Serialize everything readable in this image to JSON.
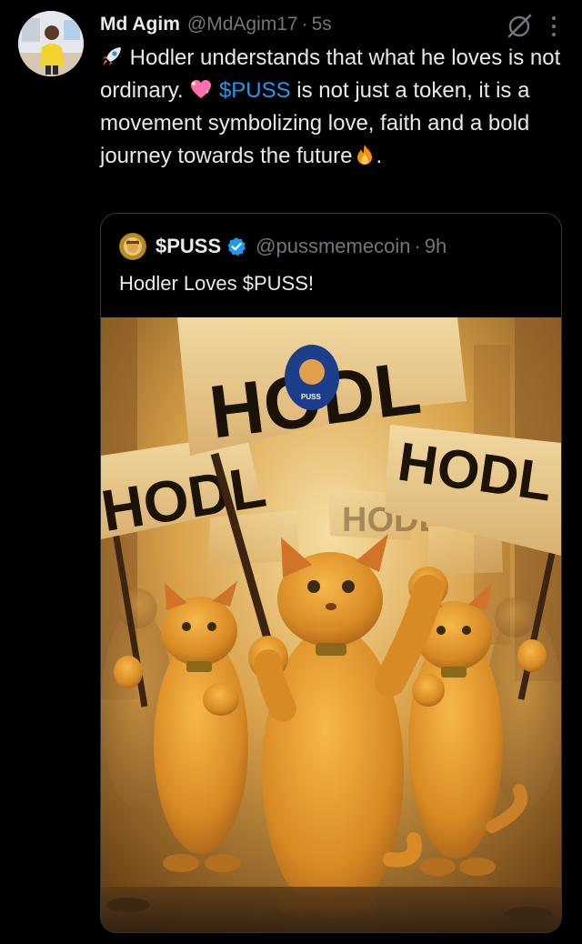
{
  "tweet": {
    "author_name": "Md Agim",
    "author_handle": "@MdAgim17",
    "separator": "·",
    "time": "5s",
    "text_part1": " Hodler understands that what he loves is not ordinary. ",
    "cashtag": "$PUSS",
    "text_part2": " is not just a token, it is a movement symbolizing love, faith and a bold journey towards the future",
    "text_end": ".",
    "icons": [
      "rocket-icon",
      "sparkling-heart-icon",
      "fire-icon",
      "grok-icon",
      "more-icon"
    ]
  },
  "quote": {
    "author_name": "$PUSS",
    "author_handle": "@pussmemecoin",
    "separator": "·",
    "time": "9h",
    "text": "Hodler Loves $PUSS!",
    "image": {
      "sign_text_main": "HODL",
      "sign_text_left": "HODL",
      "sign_text_right": "HODL",
      "sign_text_back": "HODL",
      "badge_text": "PUSS"
    }
  },
  "colors": {
    "background": "#000000",
    "text": "#e7e9ea",
    "secondary": "#71767b",
    "link": "#1d9bf0",
    "border": "#333639"
  }
}
